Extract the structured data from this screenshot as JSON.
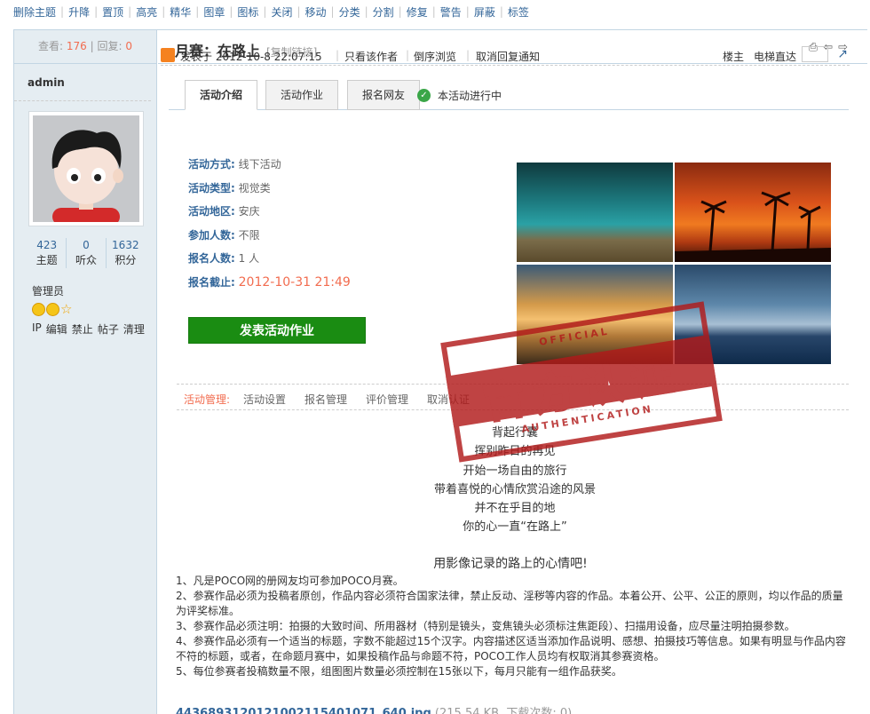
{
  "mod_actions": [
    "删除主题",
    "升降",
    "置顶",
    "高亮",
    "精华",
    "图章",
    "图标",
    "关闭",
    "移动",
    "分类",
    "分割",
    "修复",
    "警告",
    "屏蔽",
    "标签"
  ],
  "sidebar": {
    "views_label": "查看:",
    "views": "176",
    "replies_label": "回复:",
    "replies": "0",
    "username": "admin",
    "stats": [
      {
        "value": "423",
        "label": "主题"
      },
      {
        "value": "0",
        "label": "听众"
      },
      {
        "value": "1632",
        "label": "积分"
      }
    ],
    "group": "管理员",
    "actions": [
      "IP",
      "编辑",
      "禁止",
      "帖子",
      "清理"
    ]
  },
  "thread": {
    "title": "月赛：在路上",
    "copy_link": "[复制链接]"
  },
  "post_meta": {
    "posted": "发表于 2012-10-8 22:07:15",
    "author_only": "只看该作者",
    "reverse": "倒序浏览",
    "cancel_notify": "取消回复通知",
    "floor": "楼主",
    "jump_label": "电梯直达"
  },
  "tabs": [
    "活动介绍",
    "活动作业",
    "报名网友"
  ],
  "status": "本活动进行中",
  "activity": [
    {
      "key": "活动方式:",
      "value": "线下活动"
    },
    {
      "key": "活动类型:",
      "value": "视觉类"
    },
    {
      "key": "活动地区:",
      "value": "安庆"
    },
    {
      "key": "参加人数:",
      "value": "不限"
    },
    {
      "key": "报名人数:",
      "value": "1 人"
    },
    {
      "key": "报名截止:",
      "value": "2012-10-31 21:49"
    }
  ],
  "action_button": "发表活动作业",
  "manage": {
    "label": "活动管理:",
    "items": [
      "活动设置",
      "报名管理",
      "评价管理",
      "取消认证"
    ]
  },
  "stamp": {
    "top": "OFFICIAL",
    "main": "官方认证",
    "bottom": "AUTHENTICATION"
  },
  "poem": [
    "背起行囊",
    "挥别昨日的再见",
    "开始一场自由的旅行",
    "带着喜悦的心情欣赏沿途的风景",
    "并不在乎目的地",
    "你的心一直“在路上”"
  ],
  "slogan": "用影像记录的路上的心情吧!",
  "rules": [
    "1、凡是POCO网的册网友均可参加POCO月赛。",
    "2、参赛作品必须为投稿者原创，作品内容必须符合国家法律，禁止反动、淫秽等内容的作品。本着公开、公平、公正的原则，均以作品的质量为评奖标准。",
    "3、参赛作品必须注明：拍摄的大致时间、所用器材（特别是镜头，变焦镜头必须标注焦距段）、扫描用设备，应尽量注明拍摄参数。",
    "4、参赛作品必须有一个适当的标题，字数不能超过15个汉字。内容描述区适当添加作品说明、感想、拍摄技巧等信息。如果有明显与作品内容不符的标题，或者，在命题月赛中，如果投稿作品与命题不符，POCO工作人员均有权取消其参赛资格。",
    "5、每位参赛者投稿数量不限，组图图片数量必须控制在15张以下，每月只能有一组作品获奖。"
  ],
  "attachment": {
    "filename": "4436893120121002115401071_640.jpg",
    "meta": "(215.54 KB, 下载次数: 0)"
  },
  "colors": {
    "link": "#336699",
    "accent": "#f26c4f",
    "button": "#1a8c12",
    "stamp": "#b11a1a"
  }
}
